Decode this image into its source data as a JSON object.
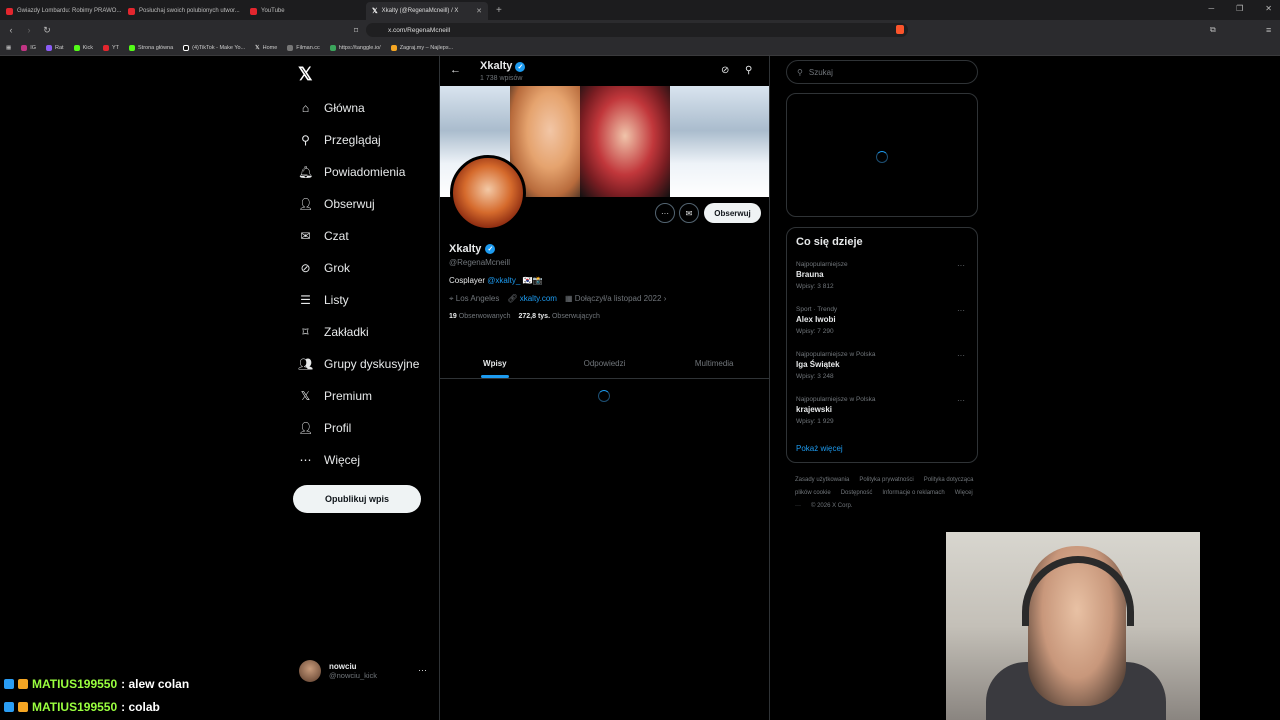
{
  "browser": {
    "tabs": [
      {
        "label": "Gwiazdy Lombardu: Robimy PRAWO...",
        "color": "#e3262e"
      },
      {
        "label": "Posłuchaj swoich polubionych utwor...",
        "color": "#e3262e"
      },
      {
        "label": "YouTube",
        "color": "#e3262e"
      },
      {
        "label": "Xkalty (@RegenaMcneill) / X",
        "color": "#ffffff"
      }
    ],
    "url": "x.com/RegenaMcneill",
    "bookmarks": [
      "IG",
      "Rat",
      "Kick",
      "YT",
      "Strona główna",
      "(4)TikTok - Make Yo...",
      "Home",
      "Filman.cc",
      "https://tanggle.io/",
      "Zagraj.my – Najleps..."
    ]
  },
  "sidebar": {
    "items": [
      {
        "label": "Główna",
        "icon": "home-icon",
        "glyph": "⌂"
      },
      {
        "label": "Przeglądaj",
        "icon": "search-icon",
        "glyph": "⚲"
      },
      {
        "label": "Powiadomienia",
        "icon": "bell-icon",
        "glyph": "🔔︎"
      },
      {
        "label": "Obserwuj",
        "icon": "follow-icon",
        "glyph": "👤︎"
      },
      {
        "label": "Czat",
        "icon": "mail-icon",
        "glyph": "✉"
      },
      {
        "label": "Grok",
        "icon": "grok-icon",
        "glyph": "⊘"
      },
      {
        "label": "Listy",
        "icon": "list-icon",
        "glyph": "☰"
      },
      {
        "label": "Zakładki",
        "icon": "bookmark-icon",
        "glyph": "⌑"
      },
      {
        "label": "Grupy dyskusyjne",
        "icon": "communities-icon",
        "glyph": "👥︎"
      },
      {
        "label": "Premium",
        "icon": "x-premium-icon",
        "glyph": "𝕏"
      },
      {
        "label": "Profil",
        "icon": "profile-icon",
        "glyph": "👤︎"
      },
      {
        "label": "Więcej",
        "icon": "more-icon",
        "glyph": "⋯"
      }
    ],
    "post_button": "Opublikuj wpis",
    "account": {
      "name": "nowciu",
      "handle": "@nowciu_kick"
    }
  },
  "profile": {
    "header_name": "Xkalty",
    "posts_count": "1 738 wpisów",
    "display_name": "Xkalty",
    "handle": "@RegenaMcneill",
    "bio_prefix": "Cosplayer",
    "bio_link": "@xkalty_",
    "bio_emoji": "🇰🇷📸",
    "location": "Los Angeles",
    "website": "xkalty.com",
    "joined": "Dołączył/a listopad 2022",
    "following_count": "19",
    "following_label": "Obserwowanych",
    "followers_count": "272,8 tys.",
    "followers_label": "Obserwujących",
    "follow_button": "Obserwuj",
    "tabs": [
      "Wpisy",
      "Odpowiedzi",
      "Multimedia"
    ]
  },
  "right": {
    "search_placeholder": "Szukaj",
    "trends_title": "Co się dzieje",
    "trends": [
      {
        "category": "Najpopularniejsze",
        "name": "Brauna",
        "count": "Wpisy: 3 812"
      },
      {
        "category": "Sport · Trendy",
        "name": "Alex Iwobi",
        "count": "Wpisy: 7 290"
      },
      {
        "category": "Najpopularniejsze w Polska",
        "name": "Iga Świątek",
        "count": "Wpisy: 3 248"
      },
      {
        "category": "Najpopularniejsze w Polska",
        "name": "krajewski",
        "count": "Wpisy: 1 929"
      }
    ],
    "show_more": "Pokaż więcej",
    "footer": [
      "Zasady użytkowania",
      "Polityka prywatności",
      "Polityka dotycząca plików cookie",
      "Dostępność",
      "Informacje o reklamach",
      "Więcej ···",
      "© 2026 X Corp."
    ]
  },
  "chat": [
    {
      "user": "MATIUS199550",
      "msg": ": alew colan"
    },
    {
      "user": "MATIUS199550",
      "msg": ": colab"
    }
  ],
  "colors": {
    "accent": "#1d9bf0",
    "chat_user": "#9aff3f"
  }
}
